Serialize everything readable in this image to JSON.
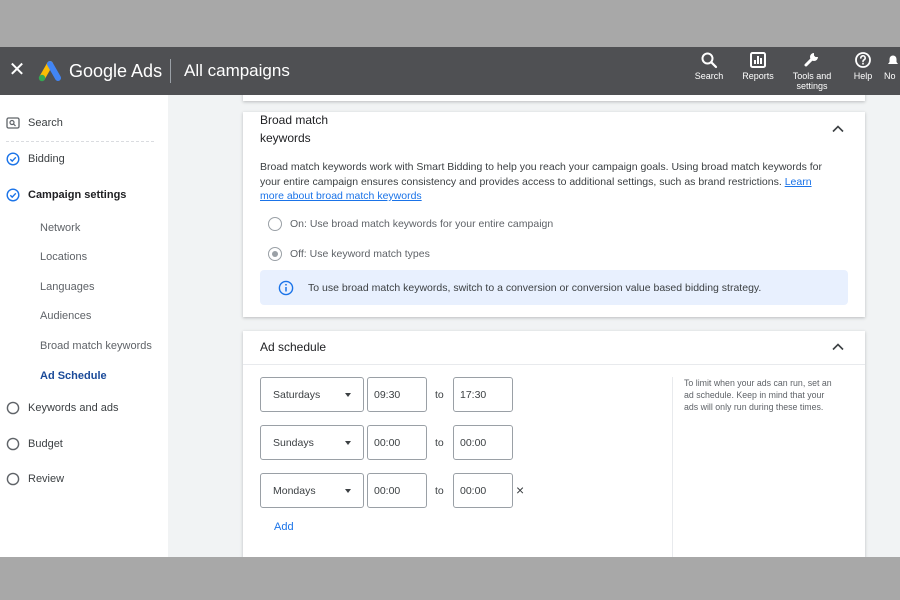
{
  "topbar": {
    "brand": "Google Ads",
    "page_title": "All campaigns",
    "tools": [
      {
        "label": "Search",
        "icon": "search-icon"
      },
      {
        "label": "Reports",
        "icon": "reports-icon"
      },
      {
        "label_line1": "Tools and",
        "label_line2": "settings",
        "icon": "wrench-icon"
      },
      {
        "label": "Help",
        "icon": "help-icon"
      },
      {
        "label": "No",
        "icon": "bell-icon"
      }
    ]
  },
  "sidebar": {
    "items": [
      {
        "label": "Search",
        "icon": "search-box-icon"
      },
      {
        "label": "Bidding",
        "icon": "check-circle-icon"
      },
      {
        "label": "Campaign settings",
        "icon": "check-circle-icon"
      },
      {
        "label": "Keywords and ads",
        "icon": "empty-circle-icon"
      },
      {
        "label": "Budget",
        "icon": "empty-circle-icon"
      },
      {
        "label": "Review",
        "icon": "empty-circle-icon"
      }
    ],
    "sub_items": [
      "Network",
      "Locations",
      "Languages",
      "Audiences",
      "Broad match keywords",
      "Ad Schedule"
    ]
  },
  "broad_match": {
    "title_line1": "Broad match",
    "title_line2": "keywords",
    "desc_line1": "Broad match keywords work with Smart Bidding to help you reach your campaign goals. Using broad match keywords for",
    "desc_line2": "your entire campaign ensures consistency and provides access to additional settings, such as brand restrictions.",
    "link_part1": "Learn",
    "link_part2": "more about broad match keywords",
    "option_on": "On: Use broad match keywords for your entire campaign",
    "option_off": "Off: Use keyword match types",
    "info": "To use broad match keywords, switch to a conversion or conversion value based bidding strategy."
  },
  "ad_schedule": {
    "title": "Ad schedule",
    "rows": [
      {
        "day": "Saturdays",
        "start": "09:30",
        "end": "17:30"
      },
      {
        "day": "Sundays",
        "start": "00:00",
        "end": "00:00"
      },
      {
        "day": "Mondays",
        "start": "00:00",
        "end": "00:00"
      }
    ],
    "to_label": "to",
    "remove_label": "×",
    "add_label": "Add",
    "help_line1": "To limit when your ads can run, set an",
    "help_line2": "ad schedule. Keep in mind that your",
    "help_line3": "ads will only run during these times."
  },
  "colors": {
    "topbar": "#4f5053",
    "accent": "#1a73e8",
    "active_nav": "#1a4a99",
    "info_bg": "#e8f0fe"
  }
}
